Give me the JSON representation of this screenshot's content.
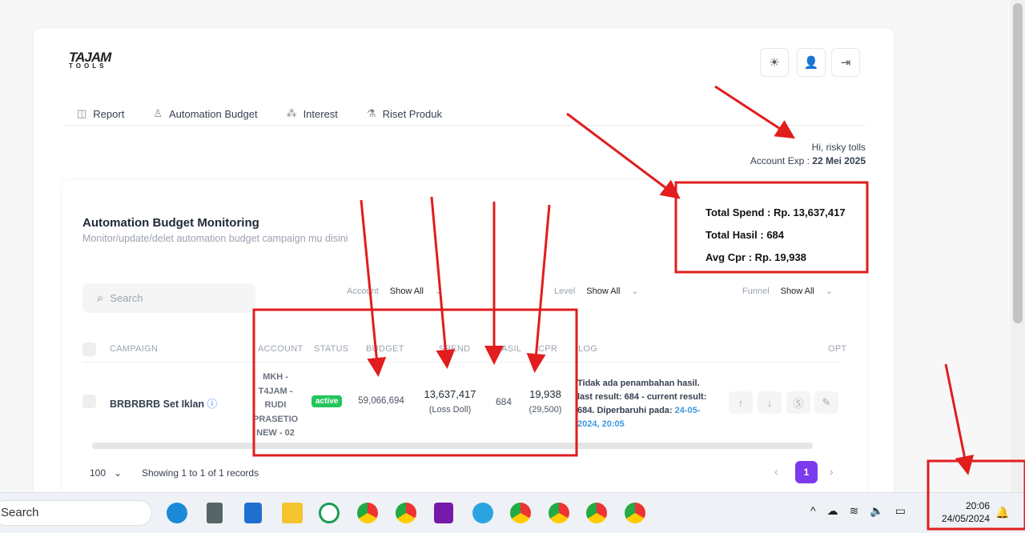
{
  "app": {
    "logo_text": "TAJAM TOOLS"
  },
  "header": {
    "icons": [
      "sun-icon",
      "user-icon",
      "logout-icon"
    ]
  },
  "nav": [
    {
      "label": "Report",
      "icon": "chart-icon"
    },
    {
      "label": "Automation Budget",
      "icon": "robot-icon"
    },
    {
      "label": "Interest",
      "icon": "people-icon"
    },
    {
      "label": "Riset Produk",
      "icon": "product-icon"
    }
  ],
  "greeting": {
    "hi": "Hi, risky tolls",
    "exp_label": "Account Exp :",
    "exp_value": "22 Mei 2025"
  },
  "totals": {
    "spend": "Total Spend : Rp. 13,637,417",
    "hasil": "Total Hasil : 684",
    "cpr": "Avg Cpr : Rp. 19,938"
  },
  "section": {
    "title": "Automation Budget Monitoring",
    "subtitle": "Monitor/update/delet automation budget campaign mu disini"
  },
  "search": {
    "placeholder": "Search"
  },
  "filters": [
    {
      "label": "Account",
      "value": "Show All"
    },
    {
      "label": "Level",
      "value": "Show All"
    },
    {
      "label": "Funnel",
      "value": "Show All"
    }
  ],
  "table": {
    "headers": [
      "CAMPAIGN",
      "ACCOUNT",
      "STATUS",
      "BUDGET",
      "SPEND",
      "HASIL",
      "CPR",
      "LOG",
      "OPT"
    ],
    "rows": [
      {
        "campaign": "BRBRBRB Set Iklan",
        "account": "MKH - T4JAM - RUDI PRASETIO NEW - 02",
        "status": "active",
        "budget": "59,066,694",
        "spend": "13,637,417",
        "spend_note": "(Loss Doll)",
        "hasil": "684",
        "cpr": "19,938",
        "cpr_note": "(29,500)",
        "log": "Tidak ada penambahan hasil. last result: 684 - current result: 684. Diperbaruhi pada: ",
        "log_time": "24-05-2024, 20:05"
      }
    ]
  },
  "pagination": {
    "page_size": "100",
    "info": "Showing 1 to 1 of 1 records",
    "current": "1"
  },
  "taskbar": {
    "search": "Search",
    "time": "20:06",
    "date": "24/05/2024"
  },
  "colors": {
    "accent": "#7c3aed",
    "active": "#22c55e",
    "link": "#3b9ae1",
    "annotation": "#e11d1d"
  }
}
